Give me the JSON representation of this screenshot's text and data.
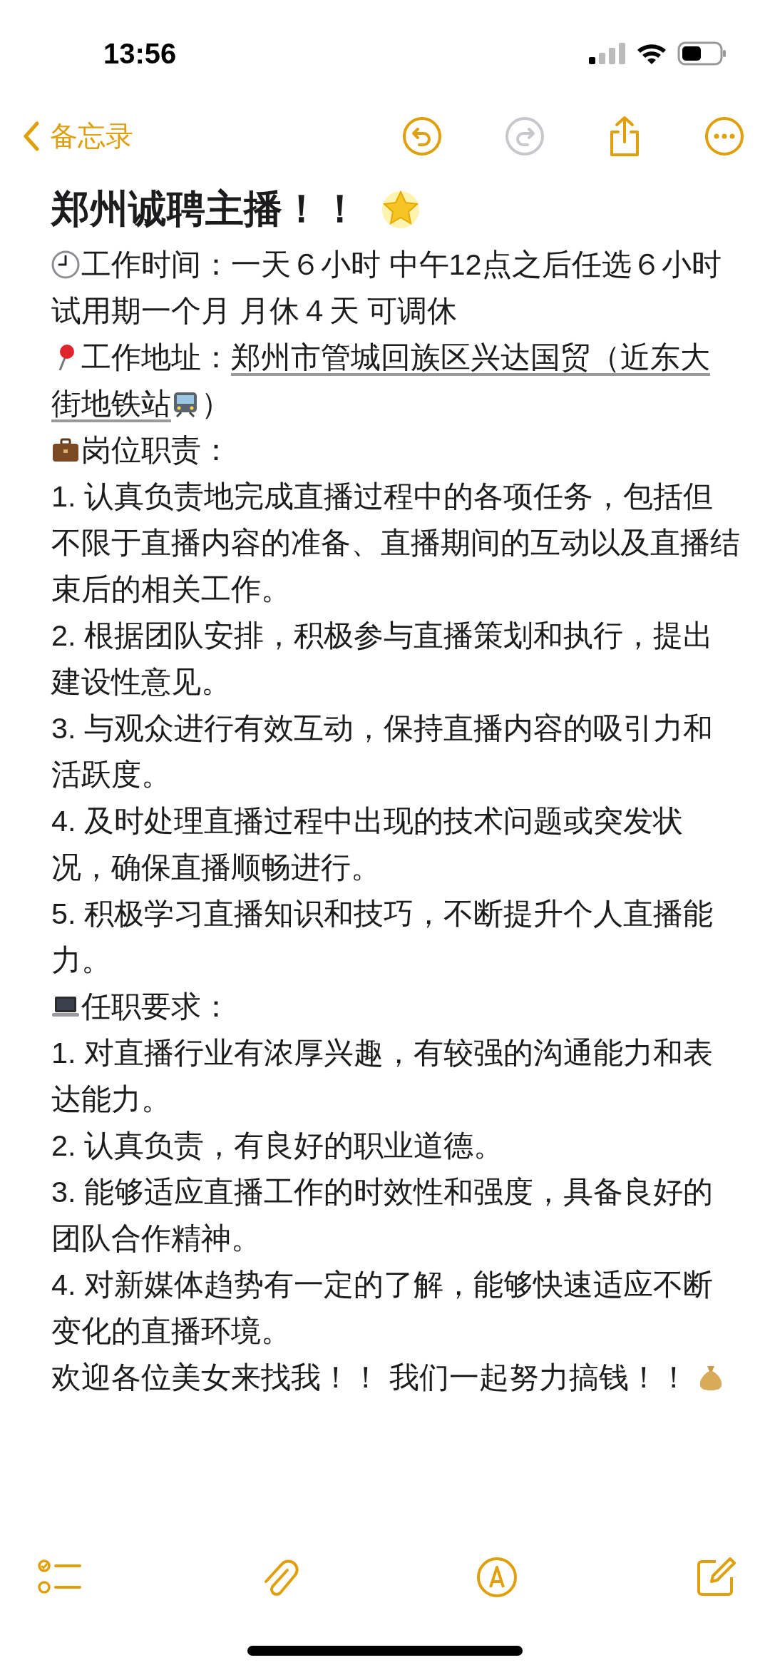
{
  "status_bar": {
    "time": "13:56"
  },
  "nav": {
    "back_label": "备忘录",
    "undo_enabled": true,
    "redo_enabled": false
  },
  "note": {
    "title": "郑州诚聘主播！！",
    "paragraphs": [
      [
        {
          "kind": "clock"
        },
        {
          "kind": "text",
          "text": "工作时间：一天６小时 中午12点之后任选６小时"
        }
      ],
      [
        {
          "kind": "text",
          "text": "试用期一个月 月休４天 可调休"
        }
      ],
      [
        {
          "kind": "pin"
        },
        {
          "kind": "label",
          "text": "工作地址："
        },
        {
          "kind": "address",
          "text": "郑州市管城回族区兴达国贸（近东大"
        },
        {
          "kind": "address",
          "text": "街地铁站"
        },
        {
          "kind": "train"
        },
        {
          "kind": "label",
          "text": "）"
        }
      ],
      [
        {
          "kind": "briefcase"
        },
        {
          "kind": "text",
          "text": "岗位职责："
        }
      ],
      [
        {
          "kind": "text",
          "text": "1. 认真负责地完成直播过程中的各项任务，包括但不限于直播内容的准备、直播期间的互动以及直播结束后的相关工作。"
        }
      ],
      [
        {
          "kind": "text",
          "text": "2. 根据团队安排，积极参与直播策划和执行，提出建设性意见。"
        }
      ],
      [
        {
          "kind": "text",
          "text": "3. 与观众进行有效互动，保持直播内容的吸引力和活跃度。"
        }
      ],
      [
        {
          "kind": "text",
          "text": "4. 及时处理直播过程中出现的技术问题或突发状况，确保直播顺畅进行。"
        }
      ],
      [
        {
          "kind": "text",
          "text": "5. 积极学习直播知识和技巧，不断提升个人直播能力。"
        }
      ],
      [
        {
          "kind": "laptop"
        },
        {
          "kind": "text",
          "text": "任职要求："
        }
      ],
      [
        {
          "kind": "text",
          "text": "1. 对直播行业有浓厚兴趣，有较强的沟通能力和表达能力。"
        }
      ],
      [
        {
          "kind": "text",
          "text": "2. 认真负责，有良好的职业道德。"
        }
      ],
      [
        {
          "kind": "text",
          "text": "3. 能够适应直播工作的时效性和强度，具备良好的团队合作精神。"
        }
      ],
      [
        {
          "kind": "text",
          "text": "4. 对新媒体趋势有一定的了解，能够快速适应不断变化的直播环境。"
        }
      ],
      [
        {
          "kind": "text",
          "text": "欢迎各位美女来找我！！ 我们一起努力搞钱！！ "
        },
        {
          "kind": "moneybag"
        }
      ]
    ]
  }
}
